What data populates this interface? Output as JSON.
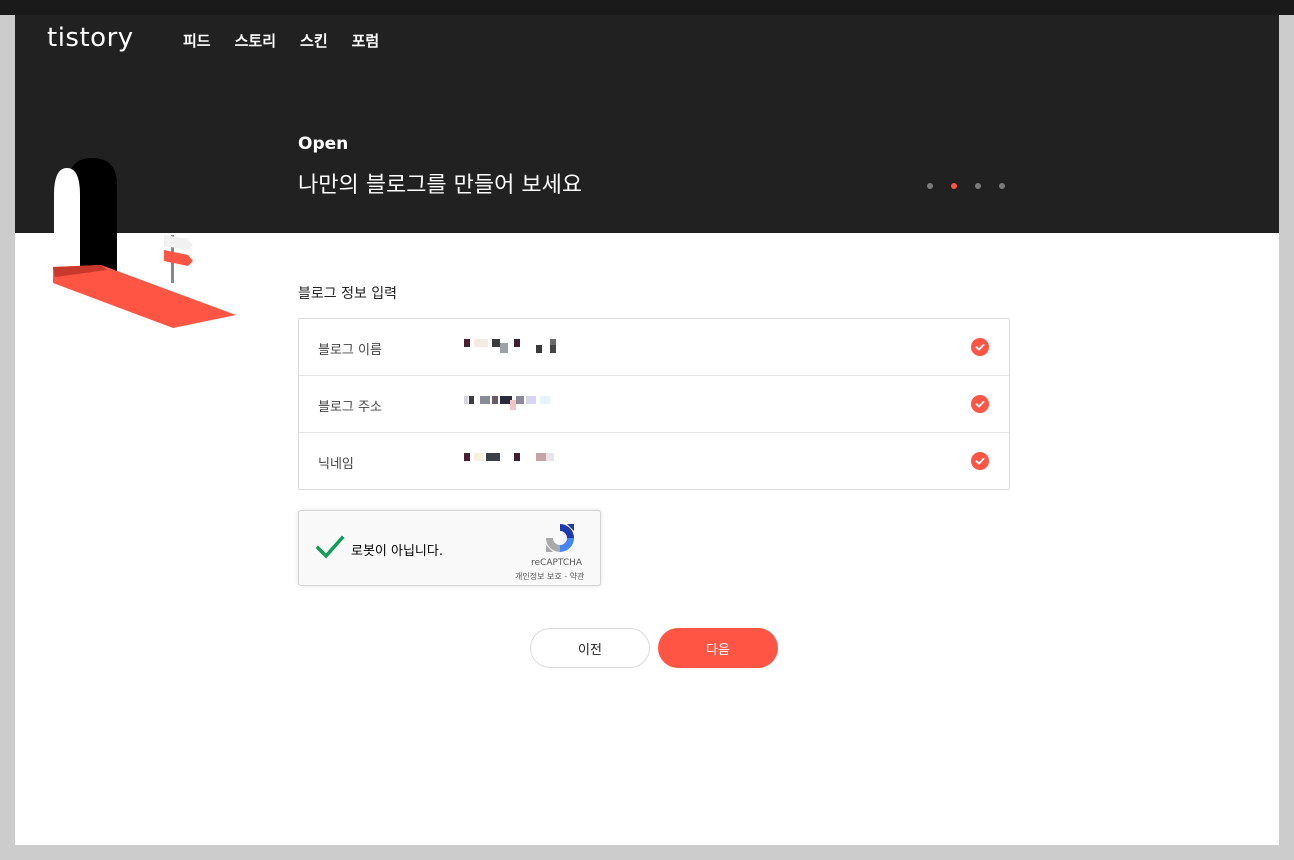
{
  "brand": {
    "logo_text": "tistory"
  },
  "nav": {
    "items": [
      {
        "label": "피드"
      },
      {
        "label": "스토리"
      },
      {
        "label": "스킨"
      },
      {
        "label": "포럼"
      }
    ]
  },
  "hero": {
    "eyebrow": "Open",
    "title": "나만의 블로그를 만들어 보세요",
    "carousel": {
      "total": 4,
      "active_index": 1
    }
  },
  "form": {
    "section_title": "블로그 정보 입력",
    "rows": [
      {
        "label": "블로그 이름"
      },
      {
        "label": "블로그 주소"
      },
      {
        "label": "닉네임"
      }
    ]
  },
  "recaptcha": {
    "label": "로봇이 아닙니다.",
    "brand": "reCAPTCHA",
    "links": "개인정보 보호 - 약관"
  },
  "buttons": {
    "prev_label": "이전",
    "next_label": "다음"
  },
  "colors": {
    "accent": "#ff5544",
    "header_bg": "#212121",
    "check_green": "#0f9d58"
  },
  "icons": {
    "row_status": "check-circle-icon",
    "captcha_state": "checkmark-icon",
    "captcha_logo": "recaptcha-logo-icon"
  }
}
